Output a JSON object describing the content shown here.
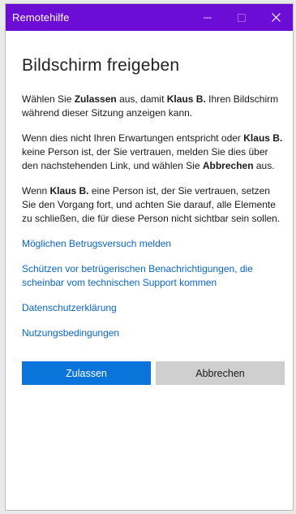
{
  "window": {
    "title": "Remotehilfe",
    "controls": {
      "minimize": "—",
      "maximize": "☐",
      "close": "✕"
    }
  },
  "main": {
    "heading": "Bildschirm freigeben",
    "paragraphs": [
      {
        "t1": "Wählen Sie ",
        "b1": "Zulassen",
        "t2": " aus, damit ",
        "b2": "Klaus B.",
        "t3": " Ihren Bildschirm während dieser Sitzung anzeigen kann."
      },
      {
        "t1": "Wenn dies nicht Ihren Erwartungen entspricht oder ",
        "b1": "Klaus B.",
        "t2": " keine Person ist, der Sie vertrauen, melden Sie dies über den nachstehenden Link, und wählen Sie ",
        "b2": "Abbrechen",
        "t3": " aus."
      },
      {
        "t1": "Wenn ",
        "b1": "Klaus B.",
        "t2": " eine Person ist, der Sie vertrauen, setzen Sie den Vorgang fort, und achten Sie darauf, alle Elemente zu schließen, die für diese Person nicht sichtbar sein sollen."
      }
    ],
    "links": [
      "Möglichen Betrugsversuch melden",
      "Schützen vor betrügerischen Benachrichtigungen, die scheinbar vom technischen Support kommen",
      "Datenschutzerklärung",
      "Nutzungsbedingungen"
    ],
    "buttons": {
      "allow": "Zulassen",
      "cancel": "Abbrechen"
    }
  },
  "colors": {
    "titlebar": "#6c0dd6",
    "primary_button": "#0a74da",
    "secondary_button": "#cfcfcf",
    "link": "#0a66c8"
  },
  "icons": [
    "minimize-icon",
    "maximize-icon",
    "close-icon"
  ]
}
